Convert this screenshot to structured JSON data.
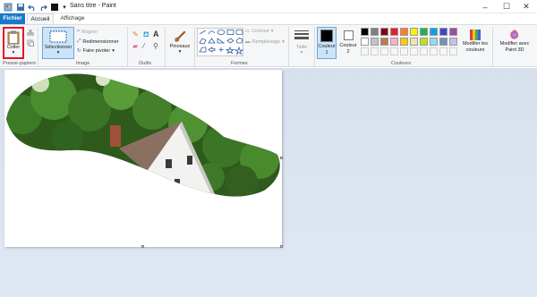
{
  "window": {
    "title": "Sans titre - Paint",
    "minimize_glyph": "–",
    "maximize_glyph": "☐",
    "close_glyph": "✕"
  },
  "tabs": {
    "file": "Fichier",
    "home": "Accueil",
    "view": "Affichage"
  },
  "clipboard": {
    "paste": "Coller",
    "group": "Presse-papiers"
  },
  "image": {
    "select": "Sélectionner",
    "crop": "Rogner",
    "resize": "Redimensionner",
    "rotate": "Faire pivoter",
    "group": "Image"
  },
  "tools": {
    "group": "Outils"
  },
  "brushes": {
    "label": "Pinceaux"
  },
  "shapes": {
    "outline": "Contour",
    "fill": "Remplissage",
    "group": "Formes"
  },
  "size": {
    "label": "Taille"
  },
  "colors": {
    "color1": "Couleur 1",
    "color2": "Couleur 2",
    "edit": "Modifier les couleurs",
    "group": "Couleurs",
    "palette_row1": [
      "#000000",
      "#7f7f7f",
      "#880015",
      "#ed1c24",
      "#ff7f27",
      "#fff200",
      "#22b14c",
      "#00a2e8",
      "#3f48cc",
      "#a349a4"
    ],
    "palette_row2": [
      "#ffffff",
      "#c3c3c3",
      "#b97a57",
      "#ffaec9",
      "#ffc90e",
      "#efe4b0",
      "#b5e61d",
      "#99d9ea",
      "#7092be",
      "#c8bfe7"
    ]
  },
  "paint3d": {
    "label": "Modifier avec Paint 3D"
  }
}
